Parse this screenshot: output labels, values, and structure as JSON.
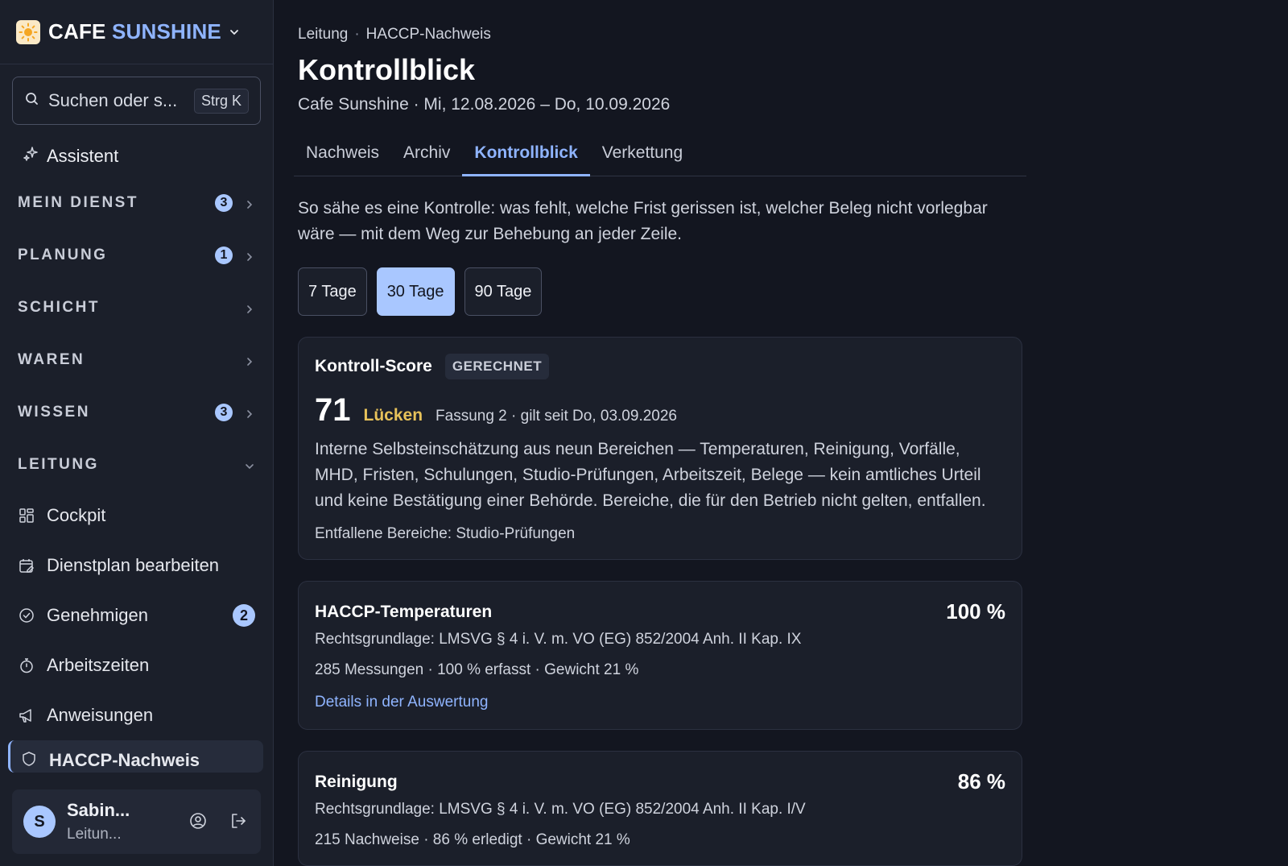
{
  "sidebar": {
    "brand_part1": "CAFE",
    "brand_part2": "SUNSHINE",
    "search_placeholder": "Suchen oder s...",
    "search_shortcut": "Strg K",
    "assistant_label": "Assistent",
    "sections": [
      {
        "label": "MEIN DIENST",
        "badge": "3"
      },
      {
        "label": "PLANUNG",
        "badge": "1"
      },
      {
        "label": "SCHICHT",
        "badge": ""
      },
      {
        "label": "WAREN",
        "badge": ""
      },
      {
        "label": "WISSEN",
        "badge": "3"
      },
      {
        "label": "LEITUNG",
        "badge": ""
      }
    ],
    "items": [
      {
        "label": "Cockpit",
        "icon": "grid-icon"
      },
      {
        "label": "Dienstplan bearbeiten",
        "icon": "calendar-edit-icon"
      },
      {
        "label": "Genehmigen",
        "icon": "check-circle-icon",
        "badge": "2"
      },
      {
        "label": "Arbeitszeiten",
        "icon": "stopwatch-icon"
      },
      {
        "label": "Anweisungen",
        "icon": "megaphone-icon"
      },
      {
        "label": "HACCP-Nachweis",
        "icon": "shield-icon"
      }
    ],
    "user": {
      "initial": "S",
      "name": "Sabin...",
      "role": "Leitun..."
    }
  },
  "main": {
    "breadcrumb": [
      "Leitung",
      "HACCP-Nachweis"
    ],
    "breadcrumb_sep": "·",
    "title": "Kontrollblick",
    "subtitle": "Cafe Sunshine · Mi, 12.08.2026 – Do, 10.09.2026",
    "tabs": [
      "Nachweis",
      "Archiv",
      "Kontrollblick",
      "Verkettung"
    ],
    "active_tab": "Kontrollblick",
    "intro": "So sähe es eine Kontrolle: was fehlt, welche Frist gerissen ist, welcher Beleg nicht vorlegbar wäre — mit dem Weg zur Behebung an jeder Zeile.",
    "ranges": [
      "7 Tage",
      "30 Tage",
      "90 Tage"
    ],
    "active_range": "30 Tage",
    "score": {
      "title": "Kontroll-Score",
      "pill": "GERECHNET",
      "value": "71",
      "status": "Lücken",
      "version": "Fassung 2 · gilt seit Do, 03.09.2026",
      "description": "Interne Selbsteinschätzung aus neun Bereichen — Temperaturen, Reinigung, Vorfälle, MHD, Fristen, Schulungen, Studio-Prüfungen, Arbeitszeit, Belege — kein amtliches Urteil und keine Bestätigung einer Behörde. Bereiche, die für den Betrieb nicht gelten, entfallen.",
      "excluded": "Entfallene Bereiche: Studio-Prüfungen"
    },
    "areas": [
      {
        "title": "HACCP-Temperaturen",
        "percent": "100 %",
        "basis": "Rechtsgrundlage: LMSVG § 4 i. V. m. VO (EG) 852/2004 Anh. II Kap. IX",
        "meta": "285 Messungen · 100 % erfasst · Gewicht 21 %",
        "link": "Details in der Auswertung"
      },
      {
        "title": "Reinigung",
        "percent": "86 %",
        "basis": "Rechtsgrundlage: LMSVG § 4 i. V. m. VO (EG) 852/2004 Anh. II Kap. I/V",
        "meta": "215 Nachweise · 86 % erledigt · Gewicht 21 %",
        "link": ""
      }
    ]
  },
  "colors": {
    "background": "#131620",
    "sidebar": "#1b1f2a",
    "accent": "#8fb4ff",
    "badge": "#a9c7ff",
    "warning": "#e7c25a"
  }
}
